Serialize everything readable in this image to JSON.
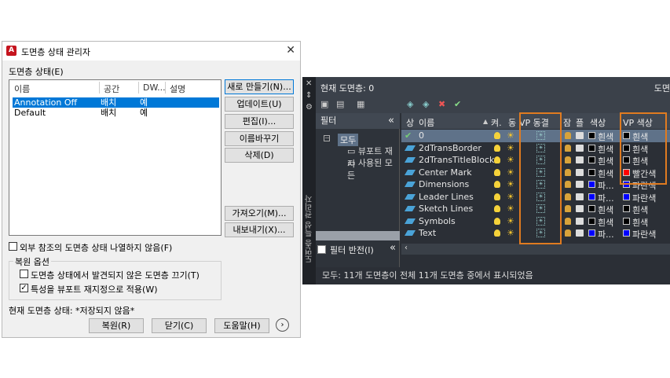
{
  "dialog": {
    "title": "도면층 상태 관리자",
    "states_label": "도면층 상태(E)",
    "columns": [
      "이름",
      "공간",
      "DW...",
      "설명"
    ],
    "rows": [
      {
        "name": "Annotation Off",
        "space": "배치",
        "dw": "예",
        "desc": ""
      },
      {
        "name": "Default",
        "space": "배치",
        "dw": "예",
        "desc": ""
      }
    ],
    "buttons": {
      "new": "새로 만들기(N)...",
      "update": "업데이트(U)",
      "edit": "편집(I)...",
      "rename": "이름바꾸기",
      "delete": "삭제(D)",
      "import": "가져오기(M)...",
      "export": "내보내기(X)..."
    },
    "xref_check": "외부 참조의 도면층 상태 나열하지 않음(F)",
    "restore_group": "복원 옵션",
    "opt_turn_off": "도면층 상태에서 발견되지 않은 도면층 끄기(T)",
    "opt_vp": "특성을 뷰포트 재지정으로 적용(W)",
    "current_state_label": "현재 도면층 상태: *저장되지 않음*",
    "footer": {
      "restore": "복원(R)",
      "close": "닫기(C)",
      "help": "도움말(H)",
      "more": "›"
    }
  },
  "panel": {
    "current_layer": "현재 도면층: 0",
    "right_cut": "도면",
    "sidebar_label": "도면층 특성 관리자",
    "filter_header": "필터",
    "collapse": "«",
    "tree": {
      "all": "모두",
      "vp_override": "뷰포트 재지",
      "used": "사용된 모든"
    },
    "invert_filter": "필터 반전(I)",
    "columns": {
      "status": "상",
      "name": "이름",
      "on": "켜.",
      "freeze": "동",
      "vp_freeze": "VP 동결",
      "lock": "잠",
      "plot": "플",
      "color": "색상",
      "vp_color": "VP 색상"
    },
    "layers": [
      {
        "name": "0",
        "color": "흰색",
        "color_hex": "#000000",
        "vp_color": "흰색",
        "vp_hex": "#000000"
      },
      {
        "name": "2dTransBorder",
        "color": "흰색",
        "color_hex": "#000000",
        "vp_color": "흰색",
        "vp_hex": "#000000"
      },
      {
        "name": "2dTransTitleBlock",
        "color": "흰색",
        "color_hex": "#000000",
        "vp_color": "흰색",
        "vp_hex": "#000000"
      },
      {
        "name": "Center Mark",
        "color": "흰색",
        "color_hex": "#000000",
        "vp_color": "빨간색",
        "vp_hex": "#ff0000"
      },
      {
        "name": "Dimensions",
        "color": "파...",
        "color_hex": "#0000ff",
        "vp_color": "파란색",
        "vp_hex": "#0000ff"
      },
      {
        "name": "Leader Lines",
        "color": "파...",
        "color_hex": "#0000ff",
        "vp_color": "파란색",
        "vp_hex": "#0000ff"
      },
      {
        "name": "Sketch Lines",
        "color": "흰색",
        "color_hex": "#000000",
        "vp_color": "흰색",
        "vp_hex": "#000000"
      },
      {
        "name": "Symbols",
        "color": "흰색",
        "color_hex": "#000000",
        "vp_color": "흰색",
        "vp_hex": "#000000"
      },
      {
        "name": "Text",
        "color": "파...",
        "color_hex": "#0000ff",
        "vp_color": "파란색",
        "vp_hex": "#0000ff"
      }
    ],
    "status_text": "모두: 11개 도면층이 전체 11개 도면층 중에서 표시되었음"
  },
  "colors": {
    "highlight_box": "#e07b20",
    "selection": "#0078d7"
  }
}
